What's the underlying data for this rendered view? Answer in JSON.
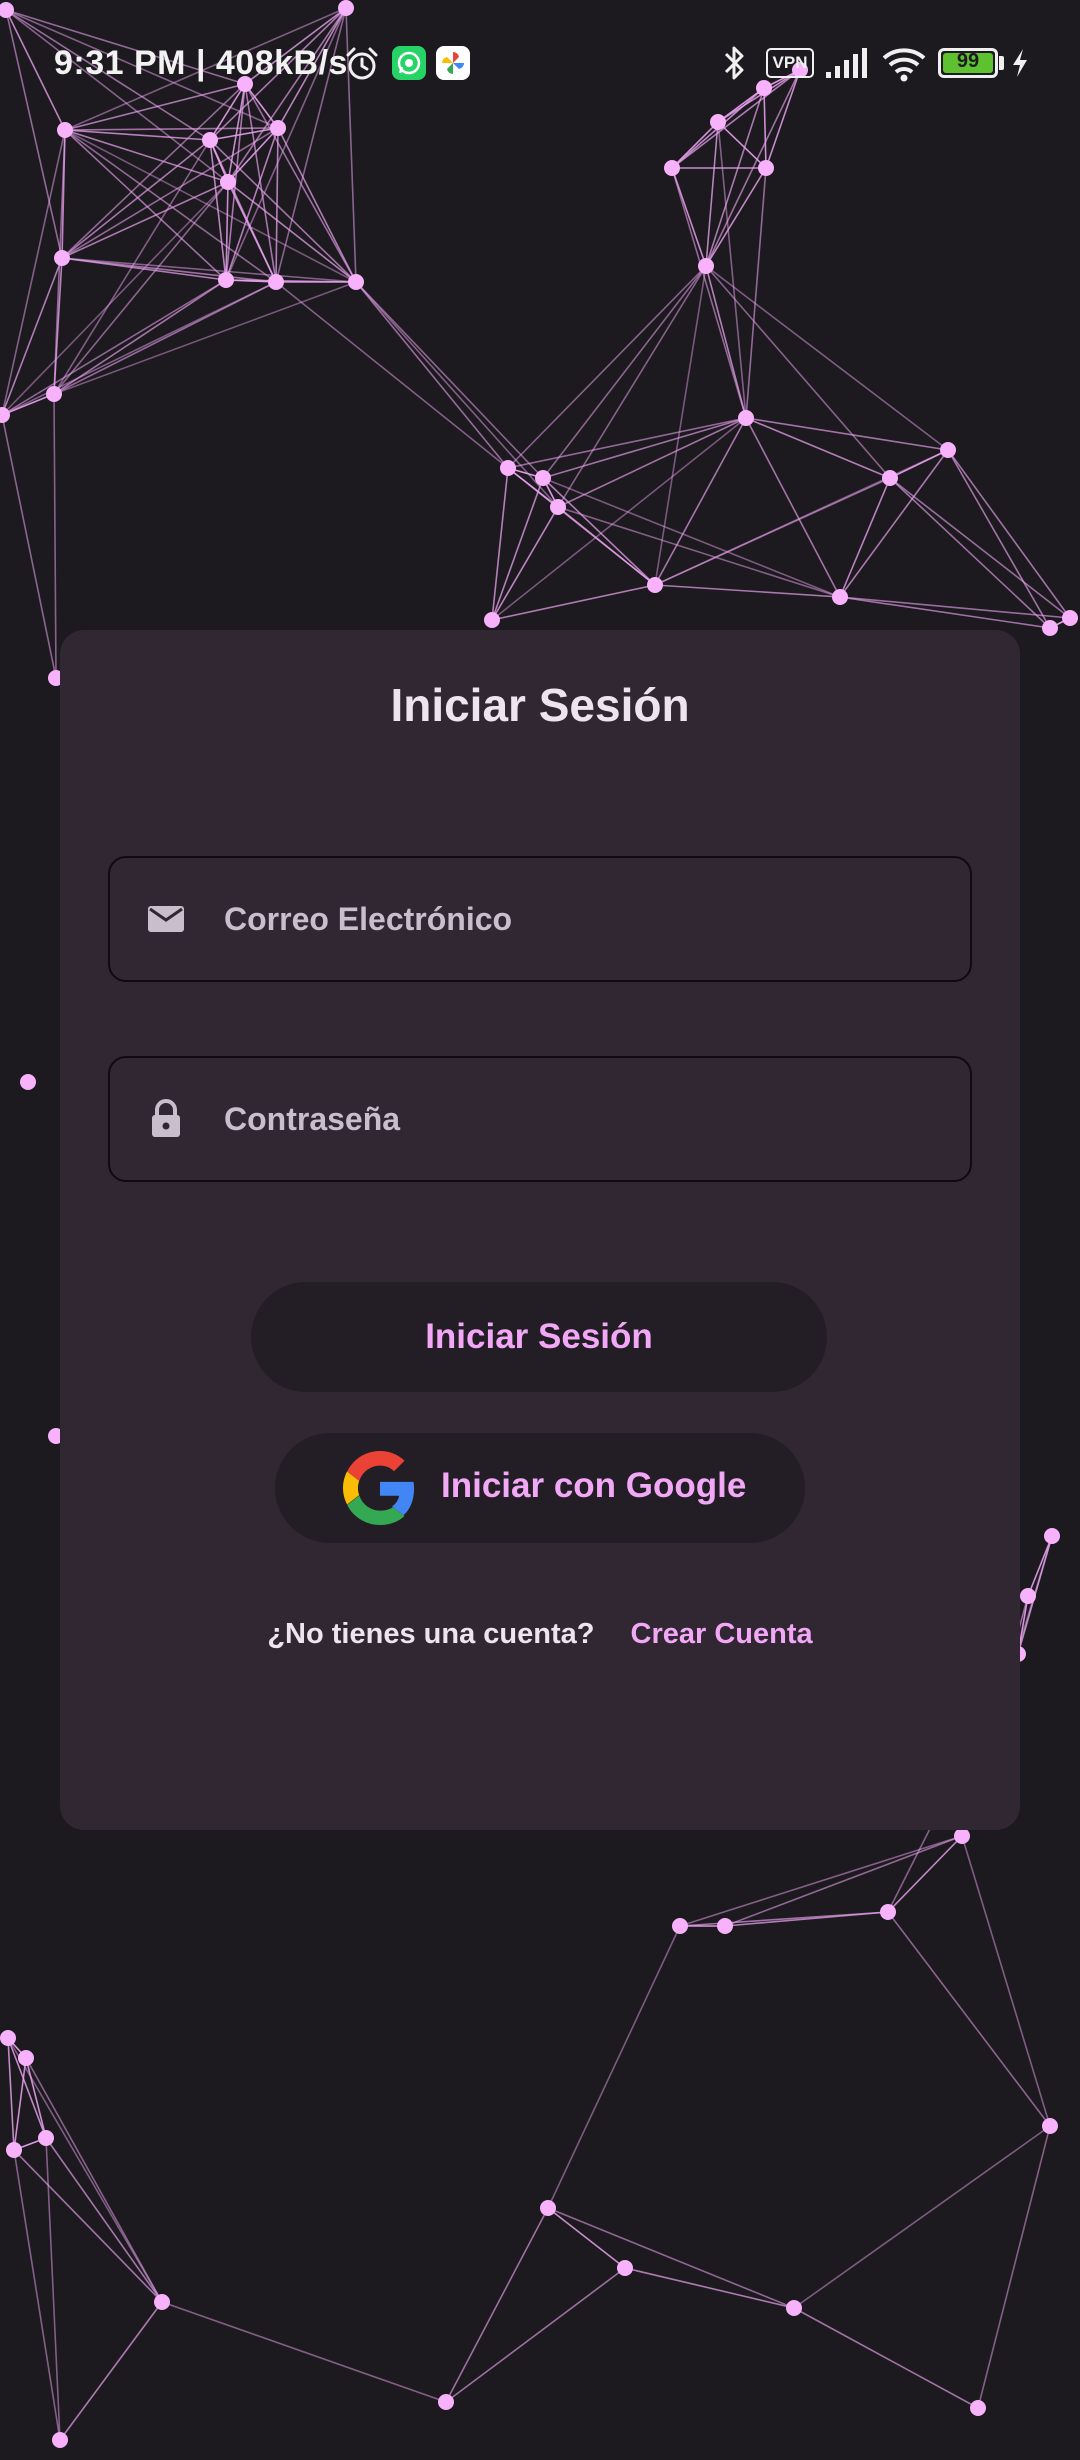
{
  "status_bar": {
    "time_speed": "9:31 PM | 408kB/s",
    "vpn_label": "VPN",
    "battery_level": "99",
    "icons": [
      "alarm-icon",
      "whatsapp-icon",
      "photos-icon",
      "bluetooth-icon",
      "vpn-icon",
      "signal-icon",
      "wifi-icon",
      "battery-icon",
      "charging-icon"
    ]
  },
  "login": {
    "title": "Iniciar Sesión",
    "email_placeholder": "Correo Electrónico",
    "email_value": "",
    "password_placeholder": "Contraseña",
    "password_value": "",
    "login_button": "Iniciar Sesión",
    "google_button": "Iniciar con Google",
    "signup_question": "¿No tienes una cuenta?",
    "signup_link": "Crear Cuenta"
  },
  "colors": {
    "background": "#1c1a1e",
    "card": "#302733",
    "accent": "#f2a8f6",
    "network_line": "#e9a2f0",
    "network_node": "#f7b2fb"
  }
}
